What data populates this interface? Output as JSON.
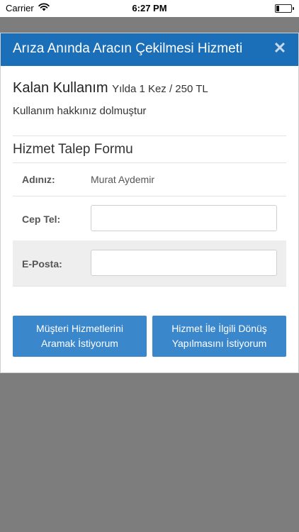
{
  "status_bar": {
    "carrier": "Carrier",
    "time": "6:27 PM",
    "battery_level": 0.2
  },
  "modal": {
    "title": "Arıza Anında Aracın Çekilmesi Hizmeti",
    "close_icon": "close-icon",
    "usage": {
      "title": "Kalan Kullanım",
      "detail": "Yılda 1 Kez / 250 TL",
      "status": "Kullanım hakkınız dolmuştur"
    },
    "form": {
      "title": "Hizmet Talep Formu",
      "name_label": "Adınız:",
      "name_value": "Murat Aydemir",
      "phone_label": "Cep Tel:",
      "phone_value": "",
      "email_label": "E-Posta:",
      "email_value": ""
    },
    "buttons": {
      "call_label": "Müşteri Hizmetlerini Aramak İstiyorum",
      "callback_label": "Hizmet İle İlgili Dönüş Yapılmasını İstiyorum"
    }
  },
  "colors": {
    "header": "#1b6fb8",
    "button": "#3a87cc",
    "overlay": "#7d7d7d"
  }
}
